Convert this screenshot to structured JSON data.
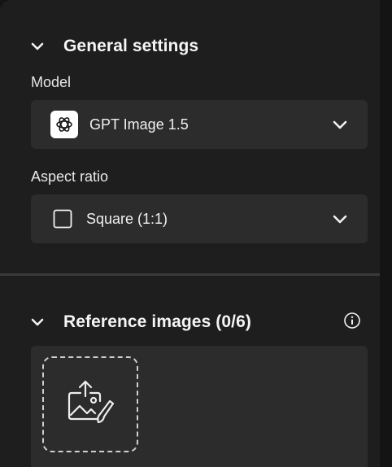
{
  "general_settings": {
    "title": "General settings",
    "model": {
      "label": "Model",
      "value": "GPT Image 1.5",
      "icon": "openai-logo-icon"
    },
    "aspect_ratio": {
      "label": "Aspect ratio",
      "value": "Square (1:1)",
      "icon": "square-icon"
    }
  },
  "reference_images": {
    "title": "Reference images (0/6)",
    "upload_icon": "upload-image-icon",
    "info_icon": "info-icon"
  },
  "colors": {
    "panel_background": "#1e1e1e",
    "control_background": "#2c2c2c",
    "text": "#f2f2f2"
  }
}
